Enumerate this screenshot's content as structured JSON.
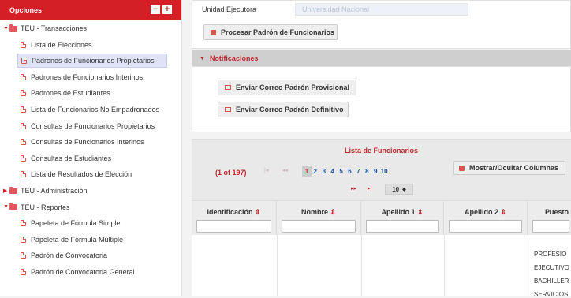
{
  "sidebar": {
    "title": "Opciones",
    "collapse_label": "−",
    "expand_label": "+",
    "nodes": [
      {
        "label": "TEU - Transacciones",
        "kind": "folder",
        "expanded": true
      },
      {
        "label": "Lista de Elecciones",
        "kind": "item"
      },
      {
        "label": "Padrones de Funcionarios Propietarios",
        "kind": "item",
        "selected": true
      },
      {
        "label": "Padrones de Funcionarios Interinos",
        "kind": "item"
      },
      {
        "label": "Padrones de Estudiantes",
        "kind": "item"
      },
      {
        "label": "Lista de Funcionarios No Empadronados",
        "kind": "item"
      },
      {
        "label": "Consultas de Funcionarios Propietarios",
        "kind": "item"
      },
      {
        "label": "Consultas de Funcionarios Interinos",
        "kind": "item"
      },
      {
        "label": "Consultas de Estudiantes",
        "kind": "item"
      },
      {
        "label": "Lista de Resultados de Elección",
        "kind": "item"
      },
      {
        "label": "TEU - Administración",
        "kind": "folder",
        "expanded": false
      },
      {
        "label": "TEU - Reportes",
        "kind": "folder",
        "expanded": true
      },
      {
        "label": "Papeleta de Fórmula Simple",
        "kind": "item"
      },
      {
        "label": "Papeleta de Fórmula Múltiple",
        "kind": "item"
      },
      {
        "label": "Padrón de Convocatoria",
        "kind": "item"
      },
      {
        "label": "Padrón de Convocatoria General",
        "kind": "item"
      }
    ]
  },
  "form": {
    "unidad_label": "Unidad Ejecutora",
    "unidad_value": "Universidad Nacional",
    "procesar_label": "Procesar Padrón de Funcionarios"
  },
  "notificaciones": {
    "title": "Notificaciones",
    "provisional_label": "Enviar Correo Padrón Provisional",
    "definitivo_label": "Enviar Correo Padrón Definitivo"
  },
  "table": {
    "title": "Lista de Funcionarios",
    "page_info": "(1 of 197)",
    "first_label": "|◂",
    "prev_label": "◂◂",
    "next_label": "▸▸",
    "last_label": "▸|",
    "pages": [
      "1",
      "2",
      "3",
      "4",
      "5",
      "6",
      "7",
      "8",
      "9",
      "10"
    ],
    "current_page": "1",
    "rows_per_page": "10",
    "toggle_columns_label": "Mostrar/Ocultar Columnas",
    "columns": [
      "Identificación",
      "Nombre",
      "Apellido 1",
      "Apellido 2",
      "Puesto"
    ],
    "puesto_values": [
      "PROFESIO",
      "EJECUTIVO",
      "BACHILLER",
      "SERVICIOS"
    ]
  },
  "colors": {
    "accent": "#d41f26",
    "link": "#1a4fa1",
    "selected_bg": "#dfe3f5"
  }
}
